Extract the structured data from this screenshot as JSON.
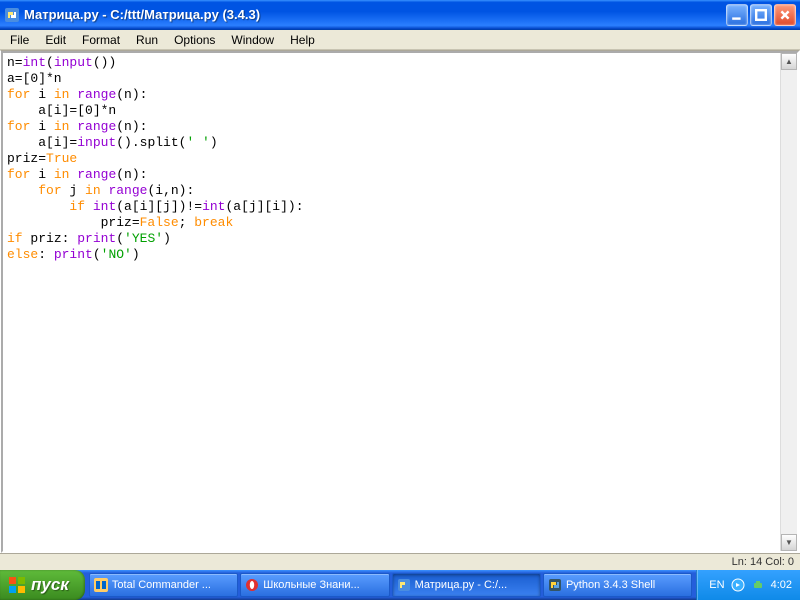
{
  "window": {
    "title": "Матрица.py - C:/ttt/Матрица.py (3.4.3)"
  },
  "menu": {
    "file": "File",
    "edit": "Edit",
    "format": "Format",
    "run": "Run",
    "options": "Options",
    "window": "Window",
    "help": "Help"
  },
  "code": {
    "l1a": "n=",
    "l1b": "int",
    "l1c": "(",
    "l1d": "input",
    "l1e": "())",
    "l2": "a=[0]*n",
    "l3a": "for",
    "l3b": " i ",
    "l3c": "in",
    "l3d": " ",
    "l3e": "range",
    "l3f": "(n):",
    "l4": "    a[i]=[0]*n",
    "l5a": "for",
    "l5b": " i ",
    "l5c": "in",
    "l5d": " ",
    "l5e": "range",
    "l5f": "(n):",
    "l6a": "    a[i]=",
    "l6b": "input",
    "l6c": "().split(",
    "l6d": "' '",
    "l6e": ")",
    "l7a": "priz=",
    "l7b": "True",
    "l8a": "for",
    "l8b": " i ",
    "l8c": "in",
    "l8d": " ",
    "l8e": "range",
    "l8f": "(n):",
    "l9a": "    ",
    "l9b": "for",
    "l9c": " j ",
    "l9d": "in",
    "l9e": " ",
    "l9f": "range",
    "l9g": "(i,n):",
    "l10a": "        ",
    "l10b": "if",
    "l10c": " ",
    "l10d": "int",
    "l10e": "(a[i][j])!=",
    "l10f": "int",
    "l10g": "(a[j][i]):",
    "l11a": "            priz=",
    "l11b": "False",
    "l11c": "; ",
    "l11d": "break",
    "l12a": "if",
    "l12b": " priz: ",
    "l12c": "print",
    "l12d": "(",
    "l12e": "'YES'",
    "l12f": ")",
    "l13a": "else",
    "l13b": ": ",
    "l13c": "print",
    "l13d": "(",
    "l13e": "'NO'",
    "l13f": ")"
  },
  "status": {
    "pos": "Ln: 14 Col: 0"
  },
  "taskbar": {
    "start": "пуск",
    "items": [
      "Total Commander ...",
      "Школьные Знани...",
      "Матрица.py - C:/...",
      "Python 3.4.3 Shell"
    ],
    "lang": "EN",
    "clock": "4:02"
  }
}
